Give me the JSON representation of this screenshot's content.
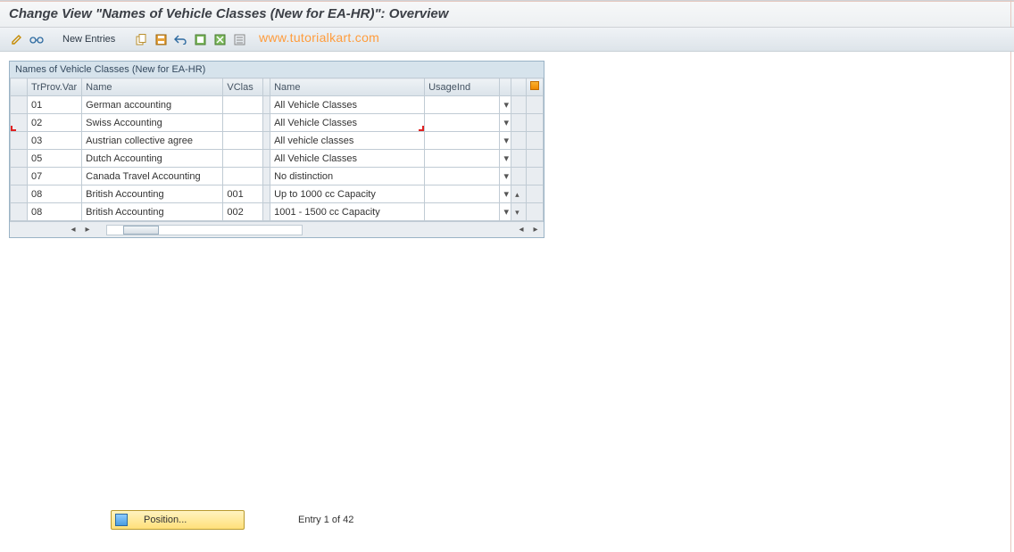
{
  "title": "Change View \"Names of Vehicle Classes (New for EA-HR)\": Overview",
  "toolbar": {
    "new_entries": "New Entries"
  },
  "watermark": "www.tutorialkart.com",
  "panel": {
    "title": "Names of Vehicle Classes (New for EA-HR)",
    "columns": {
      "trprov": "TrProv.Var",
      "name1": "Name",
      "vclas": "VClas",
      "name2": "Name",
      "usage": "UsageInd"
    },
    "rows": [
      {
        "trprov": "01",
        "name1": "German accounting",
        "vclas": "",
        "name2": "All Vehicle Classes",
        "usage": ""
      },
      {
        "trprov": "02",
        "name1": "Swiss Accounting",
        "vclas": "",
        "name2": "All Vehicle Classes",
        "usage": ""
      },
      {
        "trprov": "03",
        "name1": "Austrian collective agree",
        "vclas": "",
        "name2": "All vehicle classes",
        "usage": ""
      },
      {
        "trprov": "05",
        "name1": "Dutch Accounting",
        "vclas": "",
        "name2": "All Vehicle Classes",
        "usage": ""
      },
      {
        "trprov": "07",
        "name1": "Canada Travel Accounting",
        "vclas": "",
        "name2": "No distinction",
        "usage": ""
      },
      {
        "trprov": "08",
        "name1": "British Accounting",
        "vclas": "001",
        "name2": "Up to 1000 cc Capacity",
        "usage": ""
      },
      {
        "trprov": "08",
        "name1": "British Accounting",
        "vclas": "002",
        "name2": "1001 - 1500 cc Capacity",
        "usage": ""
      }
    ]
  },
  "footer": {
    "position_btn": "Position...",
    "entry_info": "Entry 1 of 42"
  }
}
